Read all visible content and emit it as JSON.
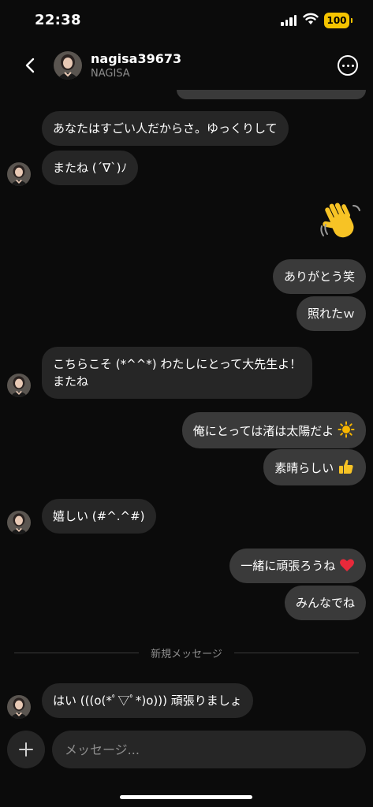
{
  "status_bar": {
    "time": "22:38",
    "battery": "100"
  },
  "header": {
    "username": "nagisa39673",
    "display_name": "NAGISA"
  },
  "messages": [
    {
      "id": "m1",
      "side": "left",
      "text": "あなたはすごい人だからさ。ゆっくりして"
    },
    {
      "id": "m2",
      "side": "left",
      "text": "またね (´∇`)ﾉ",
      "avatar": true
    },
    {
      "id": "m3",
      "side": "right",
      "emoji": "waving-hand"
    },
    {
      "id": "m4",
      "side": "right",
      "text": "ありがとう笑"
    },
    {
      "id": "m5",
      "side": "right",
      "text": "照れたｗ"
    },
    {
      "id": "m6",
      "side": "left",
      "lines": [
        "こちらこそ (*^^*) わたしにとって大先生よ！",
        "またね"
      ],
      "avatar": true
    },
    {
      "id": "m7",
      "side": "right",
      "text": "俺にとっては渚は太陽だよ",
      "emoji": "sun"
    },
    {
      "id": "m8",
      "side": "right",
      "text": "素晴らしい",
      "emoji": "thumbs-up"
    },
    {
      "id": "m9",
      "side": "left",
      "text": "嬉しい (#^.^#)",
      "avatar": true
    },
    {
      "id": "m10",
      "side": "right",
      "text": "一緒に頑張ろうね",
      "emoji": "red-heart"
    },
    {
      "id": "m11",
      "side": "right",
      "text": "みんなでね"
    },
    {
      "id": "m12",
      "side": "left",
      "text": "はい (((o(*ﾟ▽ﾟ*)o))) 頑張りましょ",
      "avatar": true
    }
  ],
  "divider": {
    "label": "新規メッセージ"
  },
  "composer": {
    "placeholder": "メッセージ..."
  },
  "colors": {
    "background": "#0b0b0b",
    "bubble_left": "#262626",
    "bubble_right": "#3a3a3a",
    "muted_text": "#8e8e8e",
    "battery": "#f5c400"
  },
  "icons": [
    "back-chevron-icon",
    "more-options-icon",
    "plus-icon",
    "wifi-icon",
    "cellular-signal-icon",
    "battery-icon"
  ]
}
